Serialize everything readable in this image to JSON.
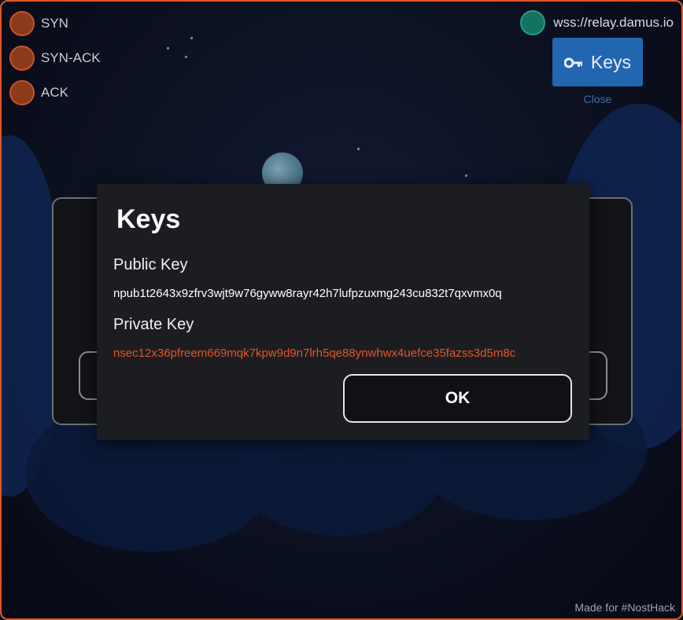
{
  "handshake": [
    {
      "label": "SYN"
    },
    {
      "label": "SYN-ACK"
    },
    {
      "label": "ACK"
    }
  ],
  "relay": {
    "url": "wss://relay.damus.io"
  },
  "keys_button": {
    "label": "Keys",
    "icon": "key-icon"
  },
  "close_link": {
    "label": "Close"
  },
  "dialog": {
    "title": "Keys",
    "public_key_label": "Public Key",
    "public_key": "npub1t2643x9zfrv3wjt9w76gyww8rayr42h7lufpzuxmg243cu832t7qxvmx0q",
    "private_key_label": "Private Key",
    "private_key": "nsec12x36pfreem669mqk7kpw9d9n7lrh5qe88ynwhwx4uefce35fazss3d5m8c",
    "ok_label": "OK"
  },
  "footer": {
    "text": "Made for #NostHack"
  },
  "colors": {
    "border": "#e0562b",
    "private_key": "#e0562b",
    "relay_connected": "#13735f",
    "keys_button": "#2266b0"
  }
}
